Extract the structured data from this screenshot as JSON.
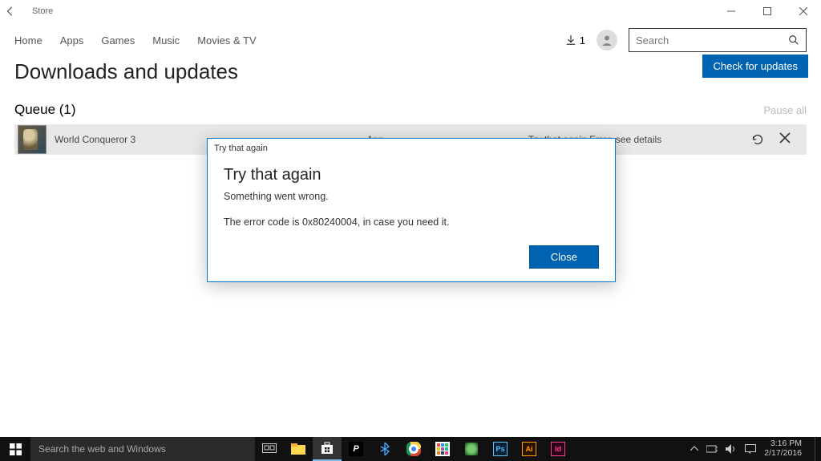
{
  "titlebar": {
    "app_title": "Store"
  },
  "nav": {
    "items": [
      "Home",
      "Apps",
      "Games",
      "Music",
      "Movies & TV"
    ],
    "downloads_count": "1",
    "search_placeholder": "Search"
  },
  "page": {
    "title": "Downloads and updates",
    "check_updates_label": "Check for updates",
    "queue_label": "Queue (1)",
    "pause_all_label": "Pause all"
  },
  "queue": {
    "items": [
      {
        "name": "World Conqueror 3",
        "type": "App",
        "status": "Try that again Error, see details"
      }
    ]
  },
  "dialog": {
    "window_title": "Try that again",
    "heading": "Try that again",
    "message": "Something went wrong.",
    "error_line": "The error code is 0x80240004, in case you need it.",
    "close_label": "Close"
  },
  "taskbar": {
    "search_placeholder": "Search the web and Windows",
    "time": "3:16 PM",
    "date": "2/17/2016"
  }
}
